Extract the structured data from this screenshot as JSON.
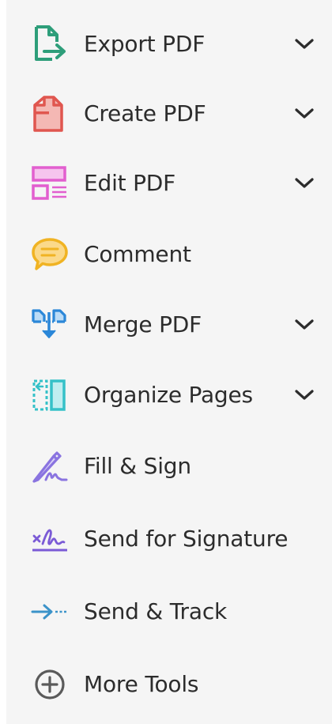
{
  "tools": [
    {
      "label": "Export PDF",
      "icon": "export-pdf-icon",
      "color": "#2e9e7a",
      "expandable": true
    },
    {
      "label": "Create PDF",
      "icon": "create-pdf-icon",
      "color": "#e0564f",
      "expandable": true
    },
    {
      "label": "Edit PDF",
      "icon": "edit-pdf-icon",
      "color": "#e25fcf",
      "expandable": true
    },
    {
      "label": "Comment",
      "icon": "comment-icon",
      "color": "#f0b323",
      "expandable": false
    },
    {
      "label": "Merge PDF",
      "icon": "merge-pdf-icon",
      "color": "#2b87d8",
      "expandable": true
    },
    {
      "label": "Organize Pages",
      "icon": "organize-pages-icon",
      "color": "#35c1c8",
      "expandable": true
    },
    {
      "label": "Fill & Sign",
      "icon": "fill-sign-icon",
      "color": "#8a74e0",
      "expandable": false
    },
    {
      "label": "Send for Signature",
      "icon": "send-for-signature-icon",
      "color": "#7b5bd6",
      "expandable": false
    },
    {
      "label": "Send & Track",
      "icon": "send-track-icon",
      "color": "#3b93c9",
      "expandable": false
    },
    {
      "label": "More Tools",
      "icon": "more-tools-icon",
      "color": "#5a5a5a",
      "expandable": false
    }
  ],
  "chevron_icon": "chevron-down-icon"
}
